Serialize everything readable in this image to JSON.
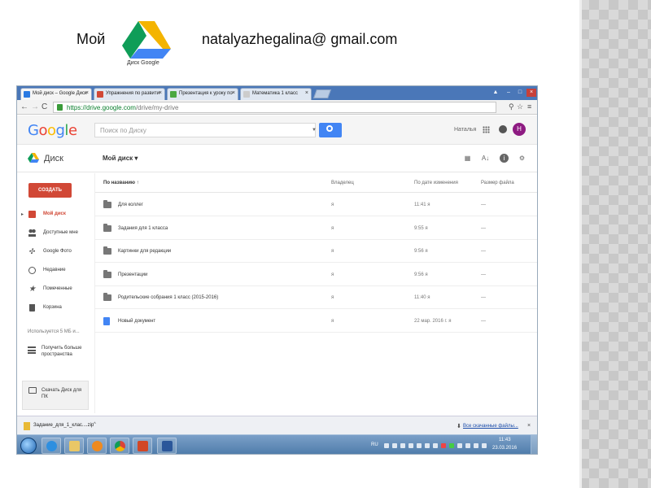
{
  "slide": {
    "title": "Мой",
    "logo_caption": "Диск Google",
    "email": "natalyazhegalina@ gmail.com"
  },
  "browser": {
    "tabs": [
      {
        "label": "Мой диск – Google Диск",
        "icon_color": "#2a7ae2"
      },
      {
        "label": "Упражнения по развити",
        "icon_color": "#d14836"
      },
      {
        "label": "Презентация к уроку по",
        "icon_color": "#4aa842"
      },
      {
        "label": "Математика 1 класс",
        "icon_color": "#cccccc"
      }
    ],
    "url_scheme": "https://",
    "url_host": "drive.google.com",
    "url_path": "/drive/my-drive"
  },
  "header": {
    "logo": "Google",
    "search_placeholder": "Поиск по Диску",
    "user_name": "Наталья",
    "avatar_letter": "Н"
  },
  "subheader": {
    "app_title": "Диск",
    "my_drive": "Мой диск ▾"
  },
  "sidebar": {
    "create": "СОЗДАТЬ",
    "items": [
      {
        "label": "Мой диск",
        "icon": "my-drive-icon"
      },
      {
        "label": "Доступные мне",
        "icon": "shared-icon"
      },
      {
        "label": "Google Фото",
        "icon": "photos-icon"
      },
      {
        "label": "Недавние",
        "icon": "clock-icon"
      },
      {
        "label": "Помеченные",
        "icon": "star-icon"
      },
      {
        "label": "Корзина",
        "icon": "trash-icon"
      }
    ],
    "storage": "Используется 5 МБ и...",
    "get_more": "Получить больше пространства",
    "download_drive": "Скачать Диск для ПК"
  },
  "filelist": {
    "columns": {
      "name": "По названию ↑",
      "owner": "Владелец",
      "modified": "По дате изменения",
      "size": "Размер файла"
    },
    "rows": [
      {
        "name": "Для коллег",
        "owner": "я",
        "modified": "11:41 я",
        "size": "—",
        "type": "folder"
      },
      {
        "name": "Задания для 1 класса",
        "owner": "я",
        "modified": "9:55 я",
        "size": "—",
        "type": "folder"
      },
      {
        "name": "Картинки для редакции",
        "owner": "я",
        "modified": "9:56 я",
        "size": "—",
        "type": "folder"
      },
      {
        "name": "Презентации",
        "owner": "я",
        "modified": "9:56 я",
        "size": "—",
        "type": "folder"
      },
      {
        "name": "Родительские собрания 1 класс (2015-2016)",
        "owner": "я",
        "modified": "11:40 я",
        "size": "—",
        "type": "folder"
      },
      {
        "name": "Новый документ",
        "owner": "я",
        "modified": "22 мар. 2016 г. я",
        "size": "—",
        "type": "doc"
      }
    ]
  },
  "shelf": {
    "file": "Задание_для_1_клас....zip",
    "show_all": "Все скачанные файлы..."
  },
  "taskbar": {
    "lang": "RU",
    "time": "11:43",
    "date": "23.03.2016"
  },
  "colors": {
    "create": "#d14836",
    "search": "#4285f4",
    "avatar": "#8e1b82",
    "taskbar": "#4c7aa9"
  }
}
